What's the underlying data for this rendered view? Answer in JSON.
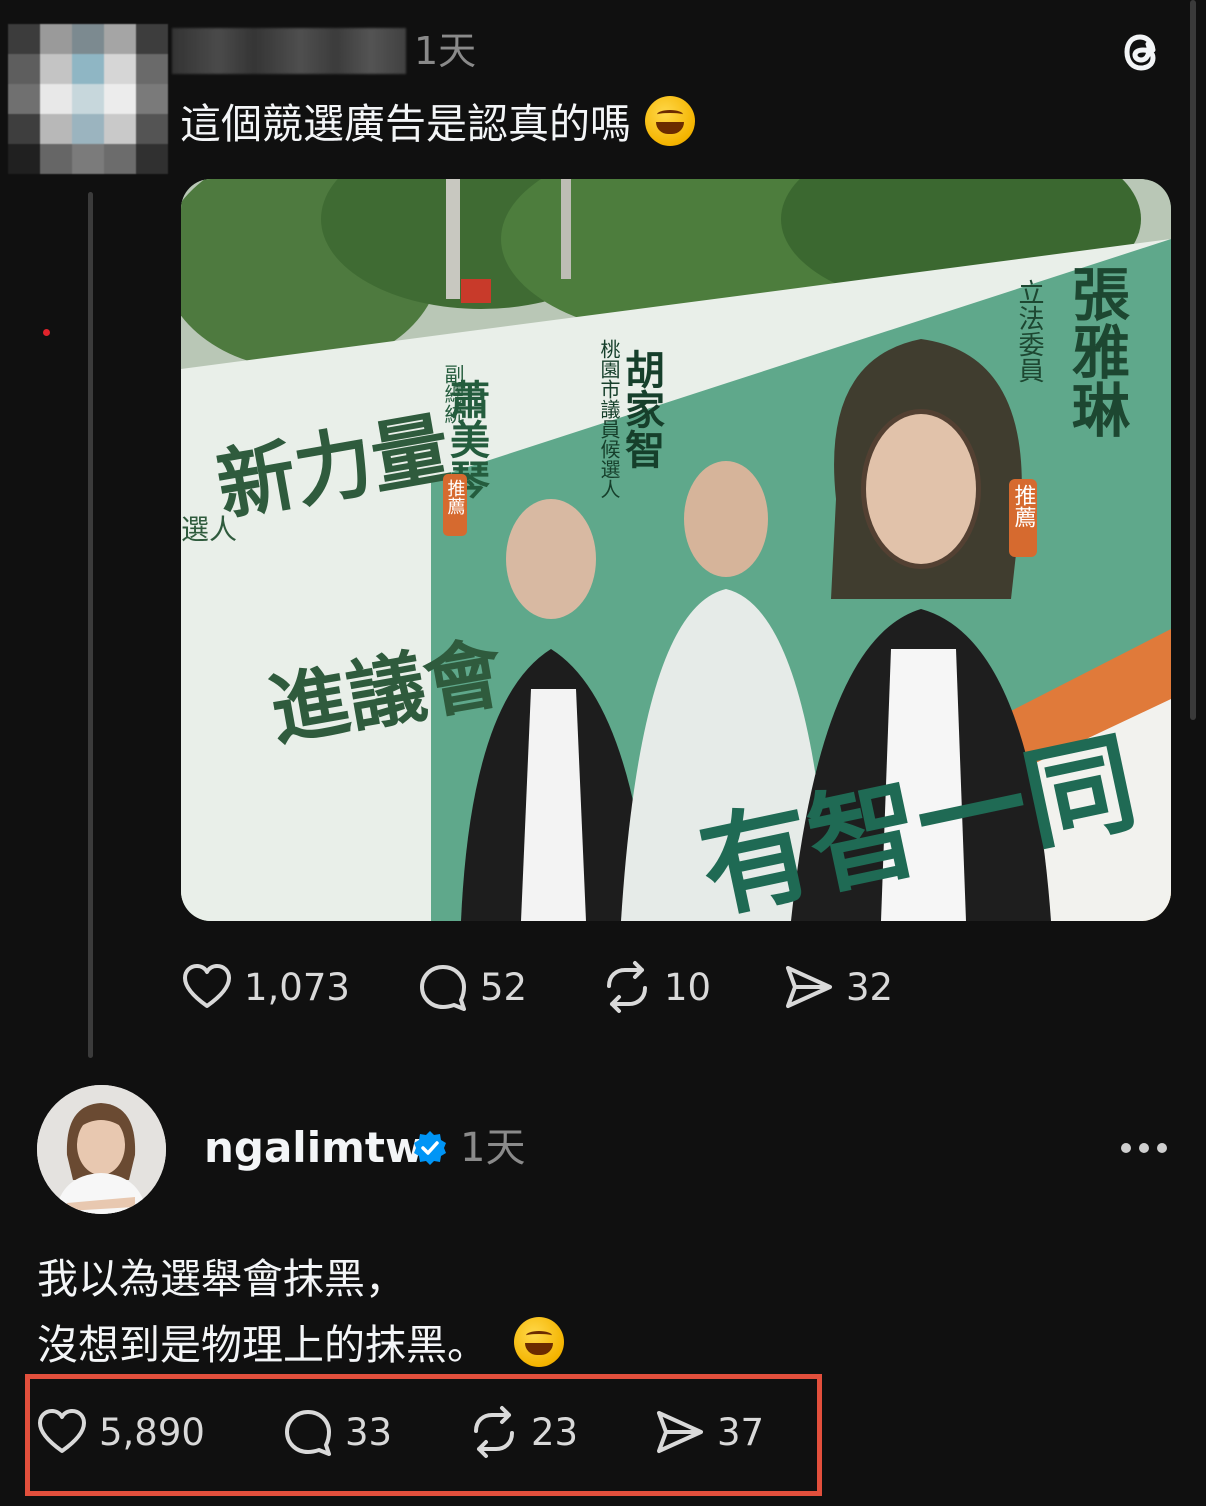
{
  "post1": {
    "time": "1天",
    "text": "這個競選廣告是認真的嗎",
    "emoji": "rofl-emoji",
    "image": {
      "board_headline_1": "新力量",
      "board_headline_2": "進議會",
      "person1_name": "蕭美琴",
      "person1_title": "副總統",
      "person1_tag": "推薦",
      "person2_name": "胡家智",
      "person2_title": "桃園市議員候選人",
      "person3_name": "張雅琳",
      "person3_title": "立法委員",
      "person3_tag": "推薦",
      "slogan": "有智一同",
      "left_partial": "選人"
    },
    "actions": {
      "likes": "1,073",
      "comments": "52",
      "reposts": "10",
      "shares": "32"
    }
  },
  "post2": {
    "username": "ngalimtw",
    "verified": true,
    "time": "1天",
    "line1": "我以為選舉會抹黑，",
    "line2": "沒想到是物理上的抹黑。",
    "emoji": "tears-of-joy-emoji",
    "actions": {
      "likes": "5,890",
      "comments": "33",
      "reposts": "23",
      "shares": "37"
    }
  },
  "colors": {
    "background": "#101010",
    "text": "#f3f5f7",
    "muted": "#8a8a8a",
    "highlight": "#e24f3c",
    "verified": "#0095f6"
  }
}
